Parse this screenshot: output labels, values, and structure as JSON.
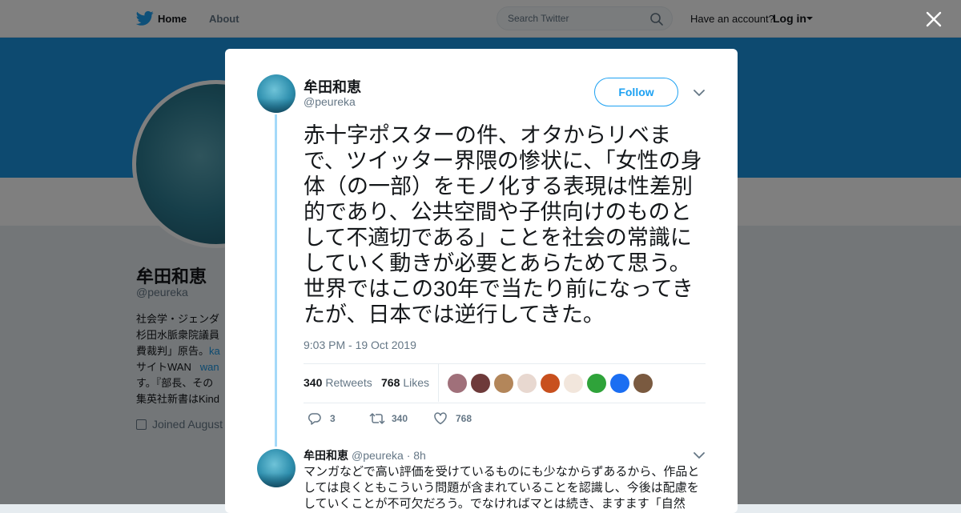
{
  "topnav": {
    "home_label": "Home",
    "about_label": "About",
    "search_placeholder": "Search Twitter",
    "have_account": "Have an account?",
    "login_label": "Log in"
  },
  "profile": {
    "name": "牟田和恵",
    "handle": "@peureka",
    "bio_lines": [
      "社会学・ジェンダ",
      "杉田水脈衆院議員",
      "費裁判」原告。",
      "サイトWAN",
      "す。『部長、その",
      "集英社新書はKind"
    ],
    "bio_link_1": "ka",
    "bio_link_2": "wan",
    "joined": "Joined August"
  },
  "tweet": {
    "author_name": "牟田和恵",
    "author_handle": "@peureka",
    "follow_label": "Follow",
    "text": "赤十字ポスターの件、オタからリベまで、ツイッター界隈の惨状に、「女性の身体（の一部）をモノ化する表現は性差別的であり、公共空間や子供向けのものとして不適切である」ことを社会の常識にしていく動きが必要とあらためて思う。世界ではこの30年で当たり前になってきたが、日本では逆行してきた。",
    "timestamp": "9:03 PM - 19 Oct 2019",
    "retweets_count": "340",
    "retweets_label": "Retweets",
    "likes_count": "768",
    "likes_label": "Likes",
    "liker_colors": [
      "#a0707a",
      "#6e3a3a",
      "#b3865a",
      "#e8d8d0",
      "#c8501e",
      "#f2e6dc",
      "#2fa33a",
      "#1b6ef2",
      "#7a5a40"
    ],
    "actions": {
      "replies": "3",
      "retweets": "340",
      "likes": "768"
    }
  },
  "reply": {
    "author_name": "牟田和恵",
    "author_handle": "@peureka",
    "time": "· 8h",
    "text": "マンガなどで高い評価を受けているものにも少なからずあるから、作品としては良くともこういう問題が含まれていることを認識し、今後は配慮をしていくことが不可欠だろう。でなければマとは続き、ますます「自然化」され、この"
  }
}
